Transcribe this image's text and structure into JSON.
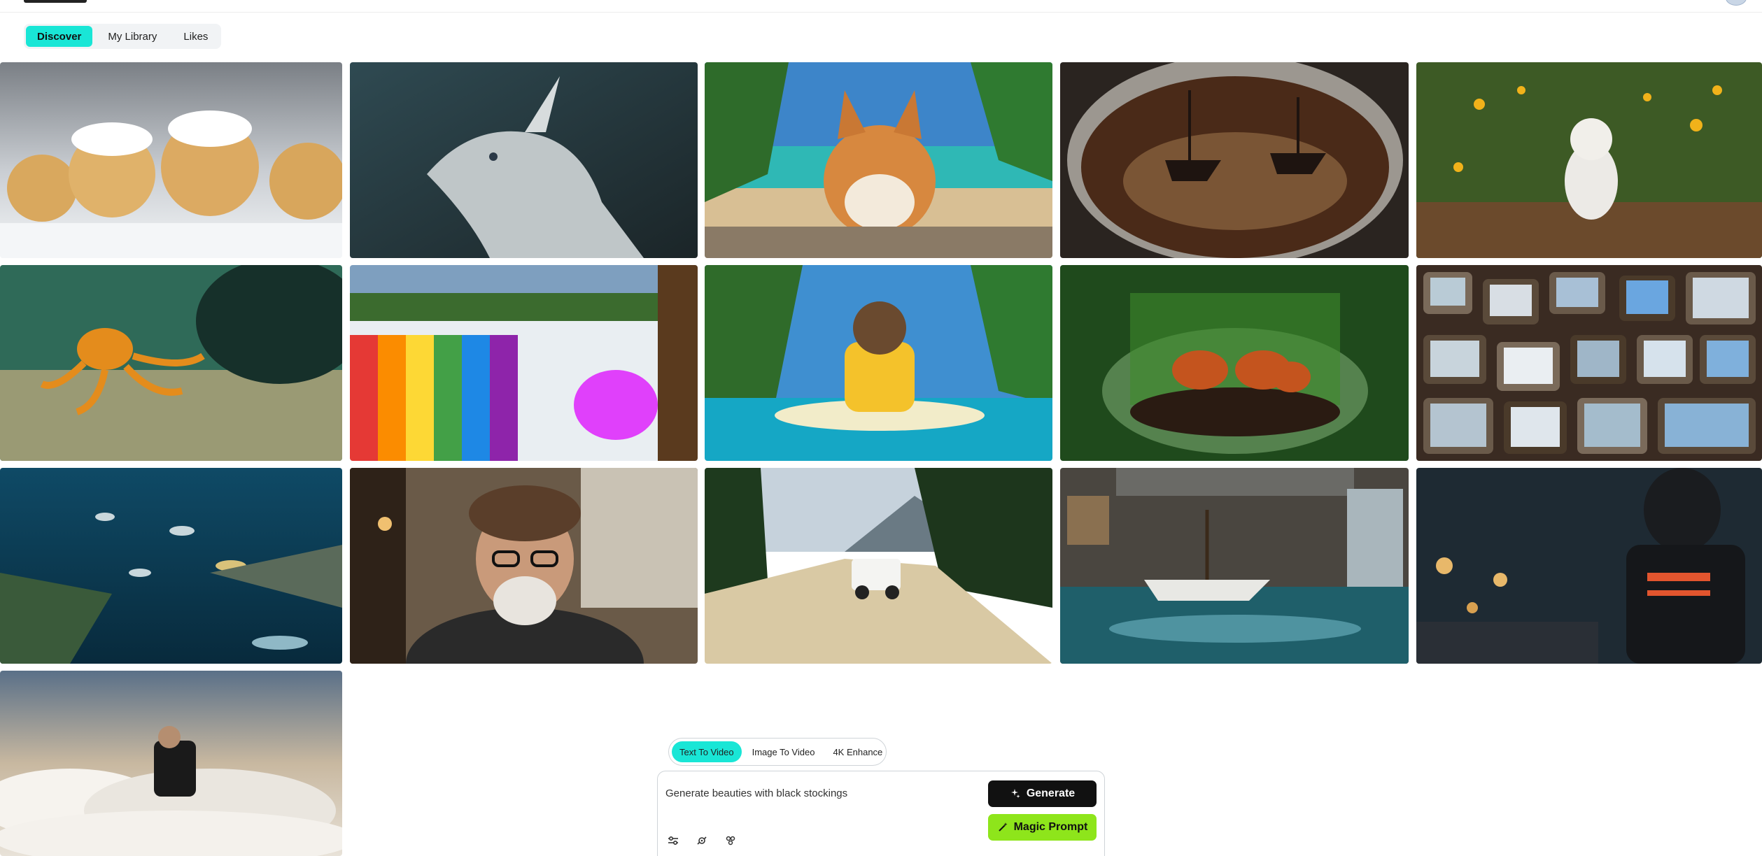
{
  "nav": {
    "tabs": [
      {
        "label": "Discover",
        "active": true
      },
      {
        "label": "My Library",
        "active": false
      },
      {
        "label": "Likes",
        "active": false
      }
    ]
  },
  "gallery": {
    "items": [
      {
        "subject": "golden retriever puppies in snow"
      },
      {
        "subject": "silver dragon"
      },
      {
        "subject": "corgi on tropical beach"
      },
      {
        "subject": "pirate ships in coffee cup"
      },
      {
        "subject": "white cat walking through flowers"
      },
      {
        "subject": "orange octopus on sea floor"
      },
      {
        "subject": "rainbow waterfall"
      },
      {
        "subject": "otter on surfboard with life vest"
      },
      {
        "subject": "red pandas in glass bowl terrarium"
      },
      {
        "subject": "wall of vintage televisions"
      },
      {
        "subject": "underwater aquarium with fish"
      },
      {
        "subject": "elderly man with beard and hat"
      },
      {
        "subject": "jeep on mountain dirt road"
      },
      {
        "subject": "boat sailing through flooded gallery"
      },
      {
        "subject": "robot on city street at night"
      },
      {
        "subject": "man reading book on clouds"
      }
    ]
  },
  "generator": {
    "modes": [
      {
        "label": "Text To Video",
        "active": true
      },
      {
        "label": "Image To Video",
        "active": false
      },
      {
        "label": "4K Enhance",
        "active": false
      }
    ],
    "prompt": "Generate beauties with black stockings",
    "generate_label": "Generate",
    "magic_label": "Magic Prompt"
  },
  "colors": {
    "accent": "#19e6d6",
    "magic": "#8ee51b",
    "generate": "#111111"
  }
}
